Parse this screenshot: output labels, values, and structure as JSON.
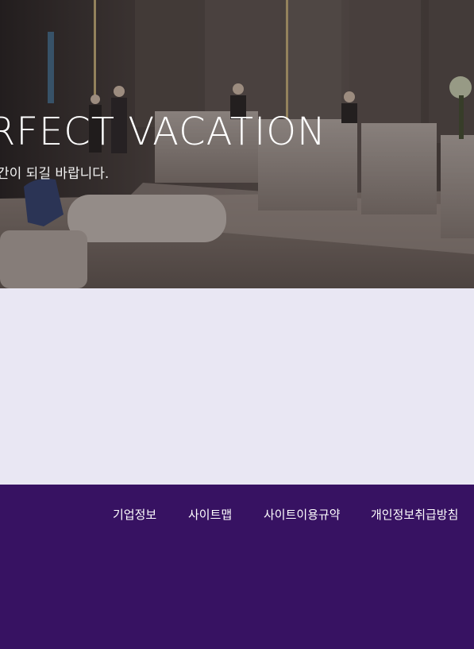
{
  "hero": {
    "title": "RFECT VACATION",
    "subtitle": "간이 되길 바랍니다."
  },
  "footer": {
    "links": [
      {
        "label": "기업정보"
      },
      {
        "label": "사이트맵"
      },
      {
        "label": "사이트이용규약"
      },
      {
        "label": "개인정보취급방침"
      }
    ]
  },
  "colors": {
    "footer_bg": "#371262",
    "content_bg": "#e9e7f3",
    "hero_overlay": "#2e2624"
  }
}
